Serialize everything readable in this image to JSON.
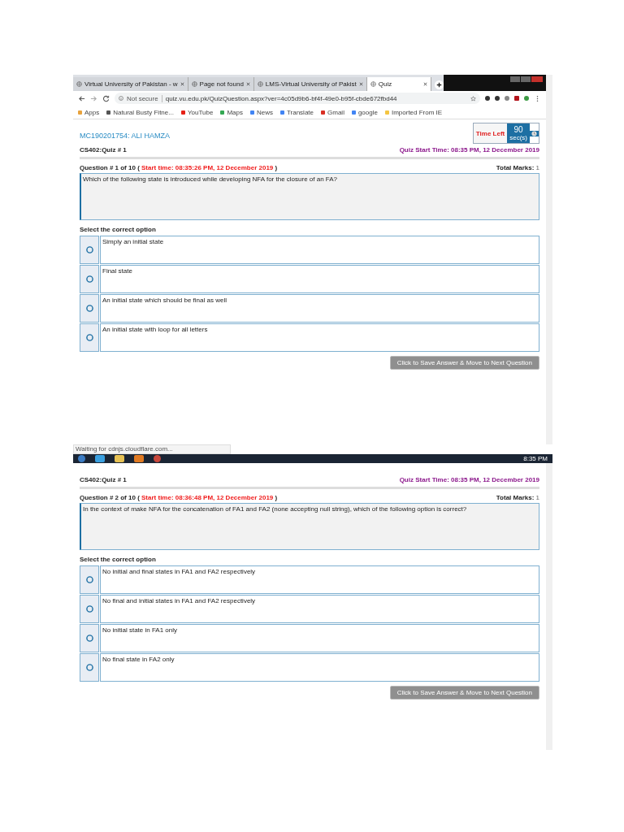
{
  "browser": {
    "tabs": [
      {
        "title": "Virtual University of Pakistan - w",
        "selected": false
      },
      {
        "title": "Page not found",
        "selected": false
      },
      {
        "title": "LMS-Virtual University of Pakist",
        "selected": false
      },
      {
        "title": "Quiz",
        "selected": true
      }
    ],
    "security": "Not secure",
    "address": "quiz.vu.edu.pk/QuizQuestion.aspx?ver=4c05d9b6-bf4f-49e0-b95f-cbde672fbd44",
    "bookmarks": [
      "Apps",
      "Natural Busty Fitne...",
      "YouTube",
      "Maps",
      "News",
      "Translate",
      "Gmail",
      "google",
      "Imported From IE"
    ]
  },
  "quizzes": [
    {
      "student": "MC190201754: ALI HAMZA",
      "timer": {
        "label": "Time Left",
        "value": "90",
        "unit": "sec(s)"
      },
      "course": "CS402:Quiz # 1",
      "quiz_start": "Quiz Start Time: 08:35 PM, 12 December 2019",
      "question_number": "Question # 1 of 10 (",
      "question_start": "Start time: 08:35:26 PM, 12 December 2019",
      "question_close": ")",
      "marks_label": "Total Marks:",
      "marks_value": "1",
      "question": "Which of the following state is introduced while developing NFA for the closure of an FA?",
      "prompt": "Select the correct option",
      "options": [
        {
          "text": "Simply an initial state",
          "selected": false
        },
        {
          "text": "Final state",
          "selected": false
        },
        {
          "text": "An initial state which should be final as well",
          "selected": false
        },
        {
          "text": "An initial state with loop for all letters",
          "selected": false
        }
      ],
      "button": {
        "label": "Click to Save Answer & Move to Next Question",
        "disabled": true
      }
    },
    {
      "course": "CS402:Quiz # 1",
      "quiz_start": "Quiz Start Time: 08:35 PM, 12 December 2019",
      "question_number": "Question # 2 of 10 (",
      "question_start": "Start time: 08:36:48 PM, 12 December 2019",
      "question_close": ")",
      "marks_label": "Total Marks:",
      "marks_value": "1",
      "question": "In the context of make NFA for the concatenation of FA1 and FA2 (none accepting null string), which of the following option is correct?",
      "prompt": "Select the correct option",
      "options": [
        {
          "text": "No initial and final states in FA1 and FA2 respectively",
          "selected": false
        },
        {
          "text": "No final and initial states in FA1 and FA2 respectively",
          "selected": false
        },
        {
          "text": "No initial state in FA1 only",
          "selected": false
        },
        {
          "text": "No final state in FA2 only",
          "selected": false
        }
      ],
      "button": {
        "label": "Click to Save Answer & Move to Next Question",
        "disabled": true
      }
    }
  ],
  "status_text": "Waiting for cdnjs.cloudflare.com...",
  "taskbar": {
    "clock": "8:35 PM"
  }
}
